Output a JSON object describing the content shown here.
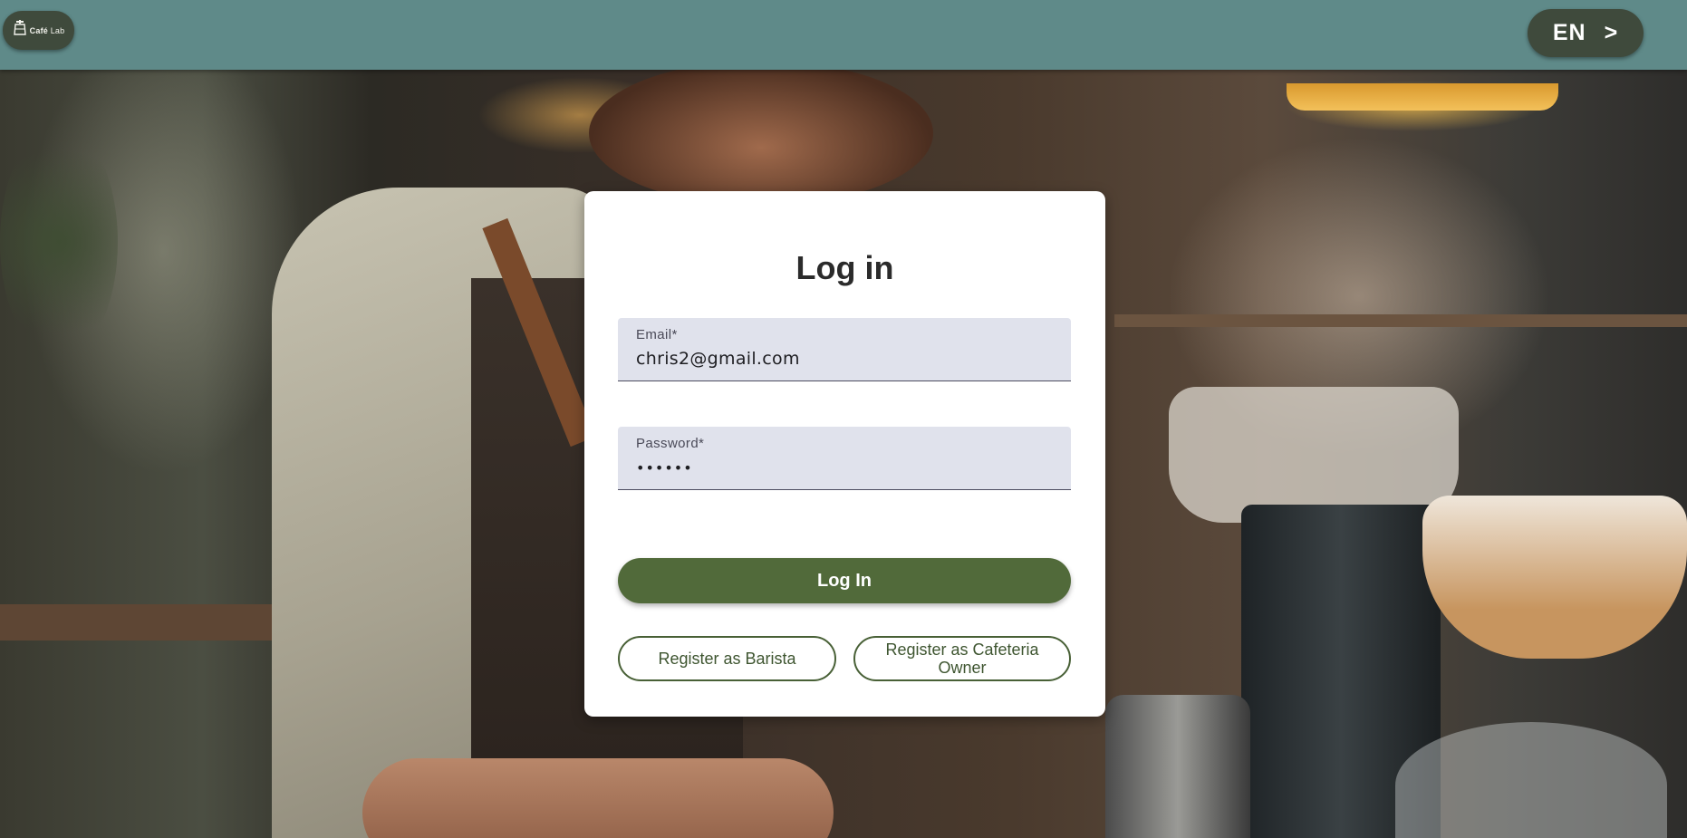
{
  "header": {
    "logo": {
      "brand": "Café",
      "suffix": "Lab",
      "icon": "coffee-press-icon"
    },
    "language": {
      "code": "EN",
      "arrow": ">"
    }
  },
  "login": {
    "title": "Log in",
    "email": {
      "label": "Email*",
      "value": "chris2@gmail.com"
    },
    "password": {
      "label": "Password*",
      "value": "••••••"
    },
    "submit_label": "Log In",
    "register_barista_label": "Register as Barista",
    "register_owner_label": "Register as Cafeteria Owner"
  },
  "colors": {
    "topbar": "#5f8a89",
    "pill_dark": "#3f4a3c",
    "primary_button": "#516a3a",
    "field_bg": "#e0e2ec"
  }
}
